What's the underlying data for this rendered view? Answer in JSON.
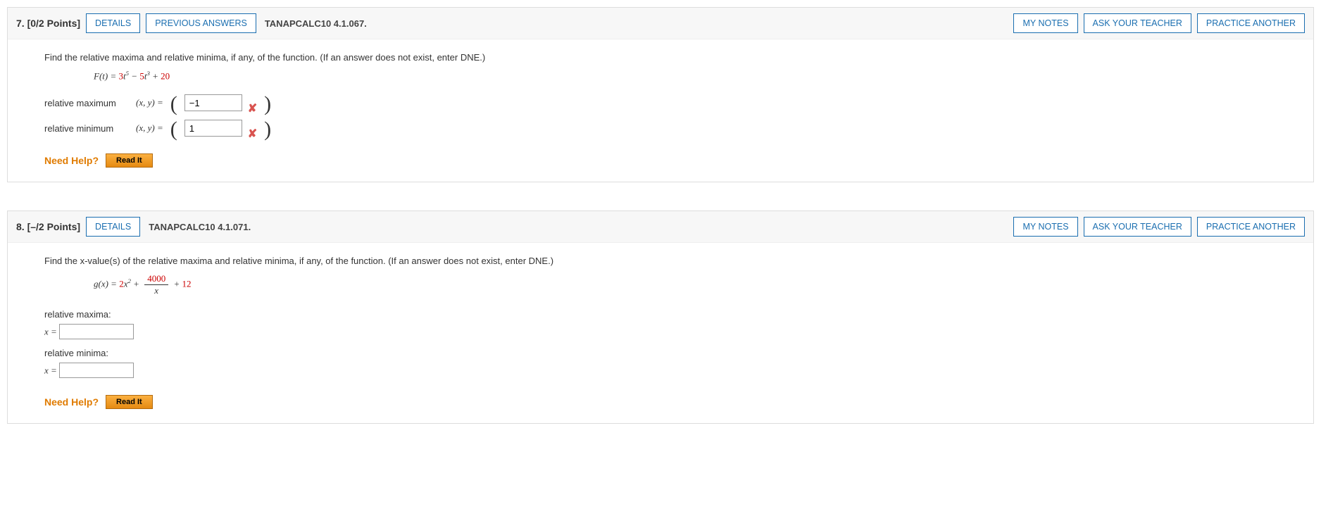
{
  "buttons": {
    "details": "DETAILS",
    "previous_answers": "PREVIOUS ANSWERS",
    "my_notes": "MY NOTES",
    "ask_teacher": "ASK YOUR TEACHER",
    "practice_another": "PRACTICE ANOTHER",
    "need_help": "Need Help?",
    "read_it": "Read It"
  },
  "q7": {
    "number": "7.",
    "points": "[0/2 Points]",
    "reference": "TANAPCALC10 4.1.067.",
    "prompt": "Find the relative maxima and relative minima, if any, of the function. (If an answer does not exist, enter DNE.)",
    "formula_plain": "F(t) = 3t^5 − 5t^3 + 20",
    "rel_max_label": "relative maximum",
    "rel_min_label": "relative minimum",
    "xy_equals": "(x, y)  =",
    "open_paren": "(",
    "close_paren": ")",
    "rel_max_value": "−1",
    "rel_min_value": "1",
    "rel_max_correct": false,
    "rel_min_correct": false
  },
  "q8": {
    "number": "8.",
    "points": "[–/2 Points]",
    "reference": "TANAPCALC10 4.1.071.",
    "prompt": "Find the x-value(s) of the relative maxima and relative minima, if any, of the function. (If an answer does not exist, enter DNE.)",
    "formula_plain": "g(x) = 2x^2 + 4000/x + 12",
    "rel_maxima_label": "relative maxima:",
    "rel_minima_label": "relative minima:",
    "x_equals": "x =",
    "rel_maxima_value": "",
    "rel_minima_value": ""
  }
}
